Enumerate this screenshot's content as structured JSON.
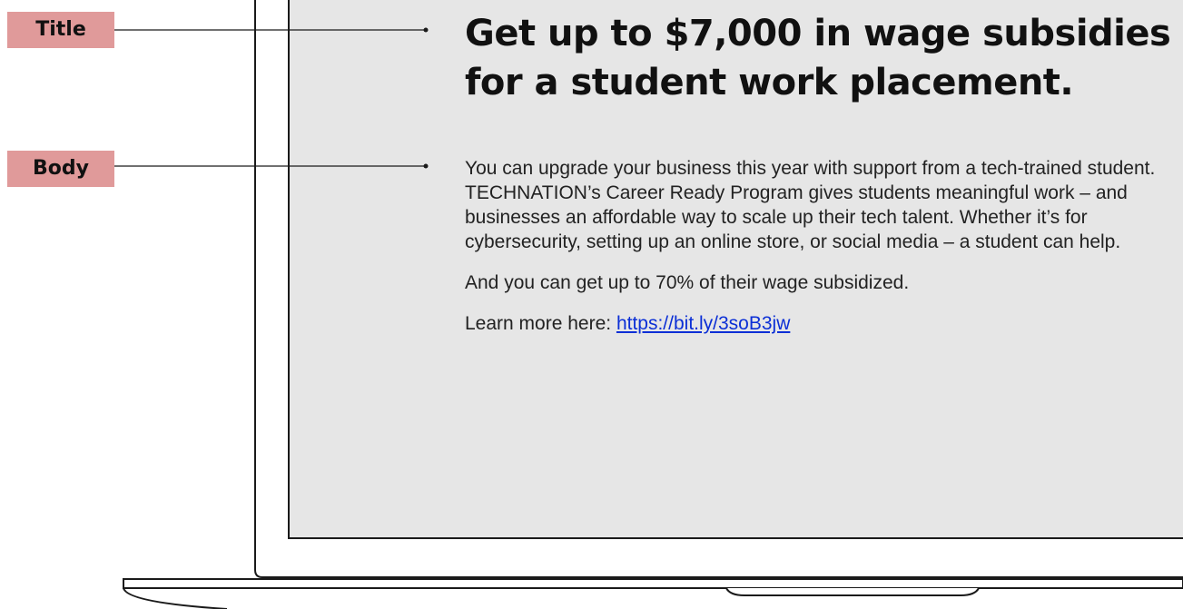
{
  "annotations": {
    "title_tag": "Title",
    "body_tag": "Body"
  },
  "post": {
    "headline": "Get up to $7,000 in wage subsidies for a student work placement.",
    "paragraph_1": "You can upgrade your business this year with support from a tech-trained student. TECHNATION’s Career Ready Program gives students meaningful work – and businesses an affordable way to scale up their tech talent. Whether it’s for cybersecurity, setting up an online store, or social media – a student can help.",
    "paragraph_2": "And you can get up to 70% of their wage subsidized.",
    "learn_more_prefix": "Learn more here: ",
    "link_text": "https://bit.ly/3soB3jw"
  },
  "colors": {
    "tag_background": "#e09a9a",
    "screen_background": "#e6e6e6",
    "link": "#0b2fd6"
  }
}
